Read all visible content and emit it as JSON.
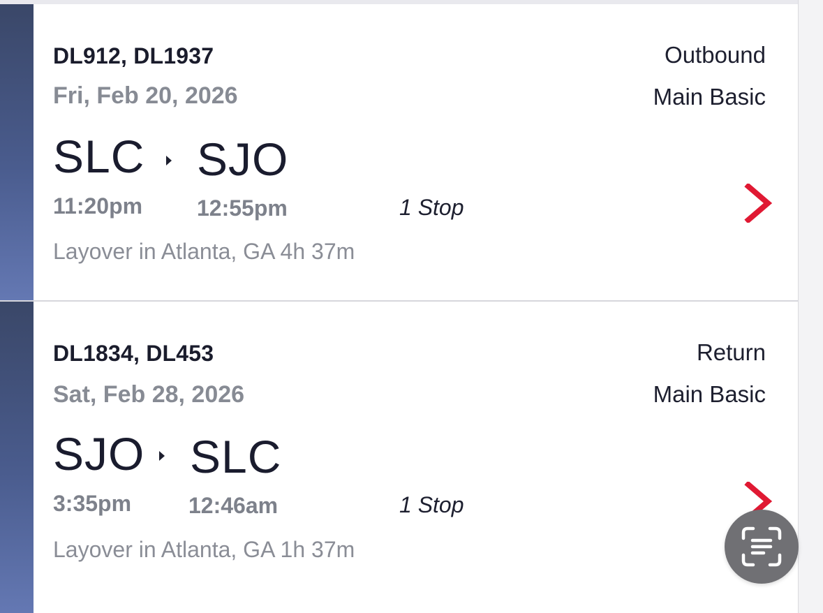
{
  "trips": [
    {
      "flights": "DL912, DL1937",
      "date": "Fri, Feb 20, 2026",
      "direction": "Outbound",
      "fare_class": "Main Basic",
      "origin": "SLC",
      "destination": "SJO",
      "depart_time": "11:20pm",
      "arrive_time": "12:55pm",
      "stops": "1 Stop",
      "layover": "Layover in Atlanta, GA 4h 37m"
    },
    {
      "flights": "DL1834, DL453",
      "date": "Sat, Feb 28, 2026",
      "direction": "Return",
      "fare_class": "Main Basic",
      "origin": "SJO",
      "destination": "SLC",
      "depart_time": "3:35pm",
      "arrive_time": "12:46am",
      "stops": "1 Stop",
      "layover": "Layover in Atlanta, GA 1h 37m"
    }
  ],
  "icons": {
    "route_arrow": "triangle-right-icon",
    "card_chevron": "chevron-right-icon",
    "scan": "text-scan-icon"
  },
  "colors": {
    "accent_bar_top": "#3a4768",
    "accent_bar_bottom": "#6478b3",
    "chevron": "#e01933",
    "secondary_text": "#878b94"
  }
}
